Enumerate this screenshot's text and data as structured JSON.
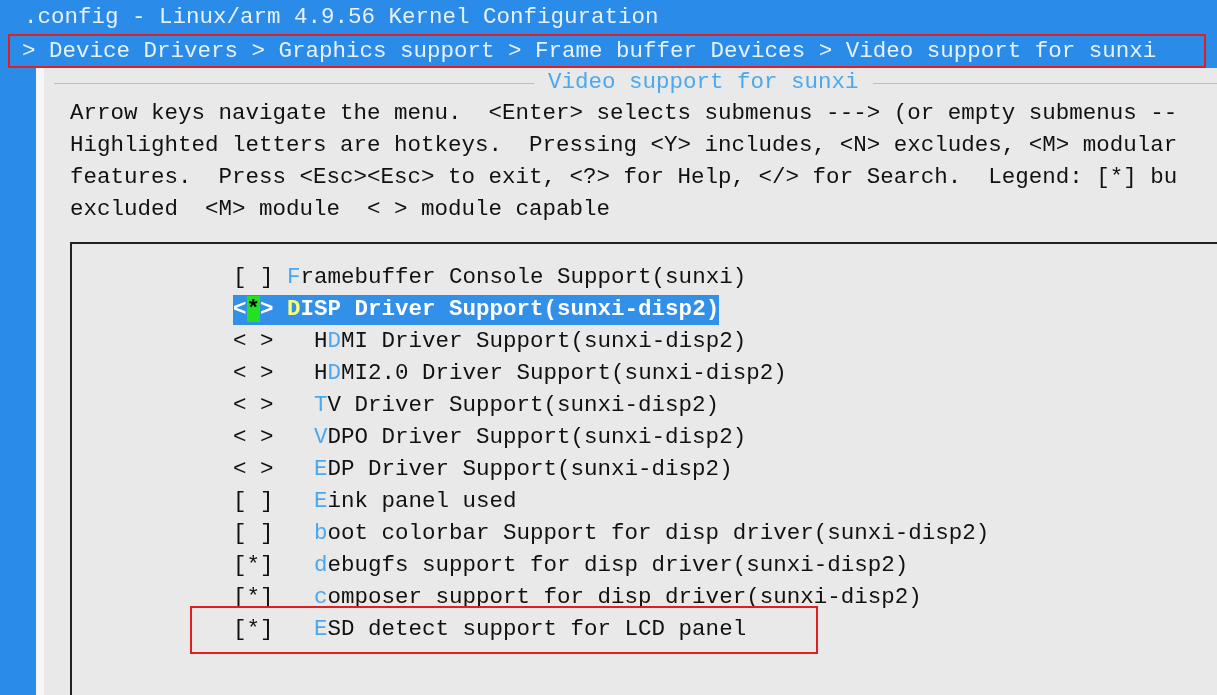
{
  "window": {
    "title": ".config - Linux/arm 4.9.56 Kernel Configuration"
  },
  "breadcrumb": {
    "text": "> Device Drivers > Graphics support > Frame buffer Devices > Video support for sunxi",
    "annotated": true
  },
  "dialog": {
    "title": "Video support for sunxi",
    "help": [
      "Arrow keys navigate the menu.  <Enter> selects submenus ---> (or empty submenus --",
      "Highlighted letters are hotkeys.  Pressing <Y> includes, <N> excludes, <M> modular",
      "features.  Press <Esc><Esc> to exit, <?> for Help, </> for Search.  Legend: [*] bu",
      "excluded  <M> module  < > module capable"
    ]
  },
  "menu": [
    {
      "prompt": "[ ]",
      "hotkey": "F",
      "rest": "ramebuffer Console Support(sunxi)",
      "selected": false,
      "annotated": false
    },
    {
      "prompt": "<*>",
      "hotkey": "D",
      "rest": "ISP Driver Support(sunxi-disp2)",
      "selected": true,
      "annotated": false,
      "children": [
        {
          "prompt": "< >",
          "prefix": "H",
          "hotkey": "D",
          "rest": "MI Driver Support(sunxi-disp2)",
          "selected": false,
          "annotated": false
        },
        {
          "prompt": "< >",
          "prefix": "H",
          "hotkey": "D",
          "rest": "MI2.0 Driver Support(sunxi-disp2)",
          "selected": false,
          "annotated": false
        },
        {
          "prompt": "< >",
          "hotkey": "T",
          "rest": "V Driver Support(sunxi-disp2)",
          "selected": false,
          "annotated": false
        },
        {
          "prompt": "< >",
          "hotkey": "V",
          "rest": "DPO Driver Support(sunxi-disp2)",
          "selected": false,
          "annotated": false
        },
        {
          "prompt": "< >",
          "hotkey": "E",
          "rest": "DP Driver Support(sunxi-disp2)",
          "selected": false,
          "annotated": false
        },
        {
          "prompt": "[ ]",
          "hotkey": "E",
          "rest": "ink panel used",
          "selected": false,
          "annotated": false
        },
        {
          "prompt": "[ ]",
          "hotkey": "b",
          "rest": "oot colorbar Support for disp driver(sunxi-disp2)",
          "selected": false,
          "annotated": false
        },
        {
          "prompt": "[*]",
          "hotkey": "d",
          "rest": "ebugfs support for disp driver(sunxi-disp2)",
          "selected": false,
          "annotated": false
        },
        {
          "prompt": "[*]",
          "hotkey": "c",
          "rest": "omposer support for disp driver(sunxi-disp2)",
          "selected": false,
          "annotated": false
        },
        {
          "prompt": "[*]",
          "hotkey": "E",
          "rest": "SD detect support for LCD panel",
          "selected": false,
          "annotated": true
        }
      ]
    }
  ]
}
